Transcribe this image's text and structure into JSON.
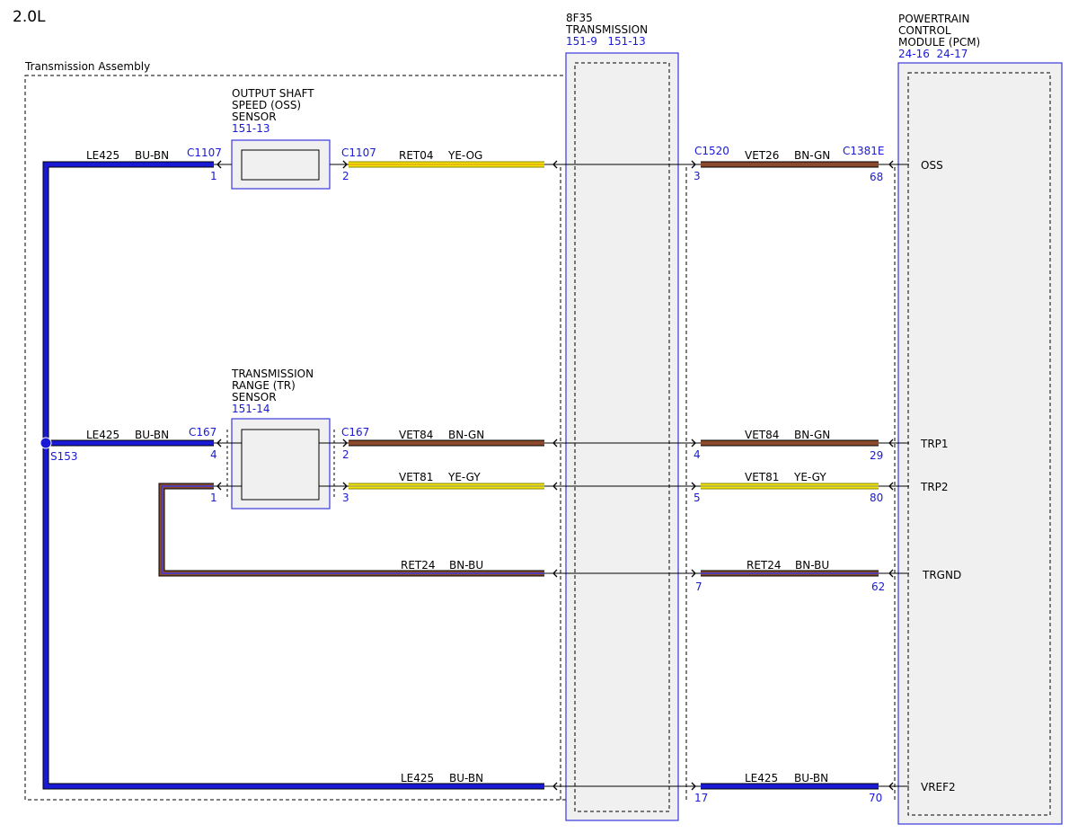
{
  "engine_label": "2.0L",
  "assembly_label": "Transmission Assembly",
  "colors": {
    "blue_wire": "#1a1ad6",
    "brown_wire": "#8b4a2b",
    "yellow_wire": "#f2e600",
    "red_wire": "#c8202a",
    "module_blue": "#3a3ae0",
    "label_blue": "#1a1ad6"
  },
  "oss_sensor": {
    "name": [
      "OUTPUT SHAFT",
      "SPEED (OSS)",
      "SENSOR"
    ],
    "ref": "151-13"
  },
  "tr_sensor": {
    "name": [
      "TRANSMISSION",
      "RANGE (TR)",
      "SENSOR"
    ],
    "ref": "151-14"
  },
  "transmission_module": {
    "name": [
      "8F35",
      "TRANSMISSION"
    ],
    "refs": "151-9   151-13"
  },
  "pcm_module": {
    "name": [
      "POWERTRAIN",
      "CONTROL",
      "MODULE (PCM)"
    ],
    "refs": "24-16  24-17"
  },
  "splice": {
    "label": "S153"
  },
  "connectors": {
    "oss_left": "C1107",
    "oss_right": "C1107",
    "tr_left": "C167",
    "tr_right": "C167",
    "c1520": "C1520",
    "c1381e": "C1381E"
  },
  "left_circuits": [
    {
      "circuit": "LE425",
      "color": "BU-BN",
      "pin": "1"
    },
    {
      "circuit": "LE425",
      "color": "BU-BN",
      "pin": "4"
    }
  ],
  "mid_circuits": [
    {
      "circuit": "RET04",
      "color": "YE-OG",
      "pin": "2"
    },
    {
      "circuit": "VET84",
      "color": "BN-GN",
      "pin": "2"
    },
    {
      "circuit": "VET81",
      "color": "YE-GY",
      "pin": "3"
    },
    {
      "circuit": "RET24",
      "color": "BN-BU",
      "pin": "1"
    },
    {
      "circuit": "LE425",
      "color": "BU-BN",
      "pin": ""
    }
  ],
  "right_circuits": [
    {
      "circuit": "VET26",
      "color": "BN-GN",
      "pin_c1520": "3",
      "pin_pcm": "68",
      "signal": "OSS"
    },
    {
      "circuit": "VET84",
      "color": "BN-GN",
      "pin_c1520": "4",
      "pin_pcm": "29",
      "signal": "TRP1"
    },
    {
      "circuit": "VET81",
      "color": "YE-GY",
      "pin_c1520": "5",
      "pin_pcm": "80",
      "signal": "TRP2"
    },
    {
      "circuit": "RET24",
      "color": "BN-BU",
      "pin_c1520": "7",
      "pin_pcm": "62",
      "signal": "TRGND"
    },
    {
      "circuit": "LE425",
      "color": "BU-BN",
      "pin_c1520": "17",
      "pin_pcm": "70",
      "signal": "VREF2"
    }
  ]
}
